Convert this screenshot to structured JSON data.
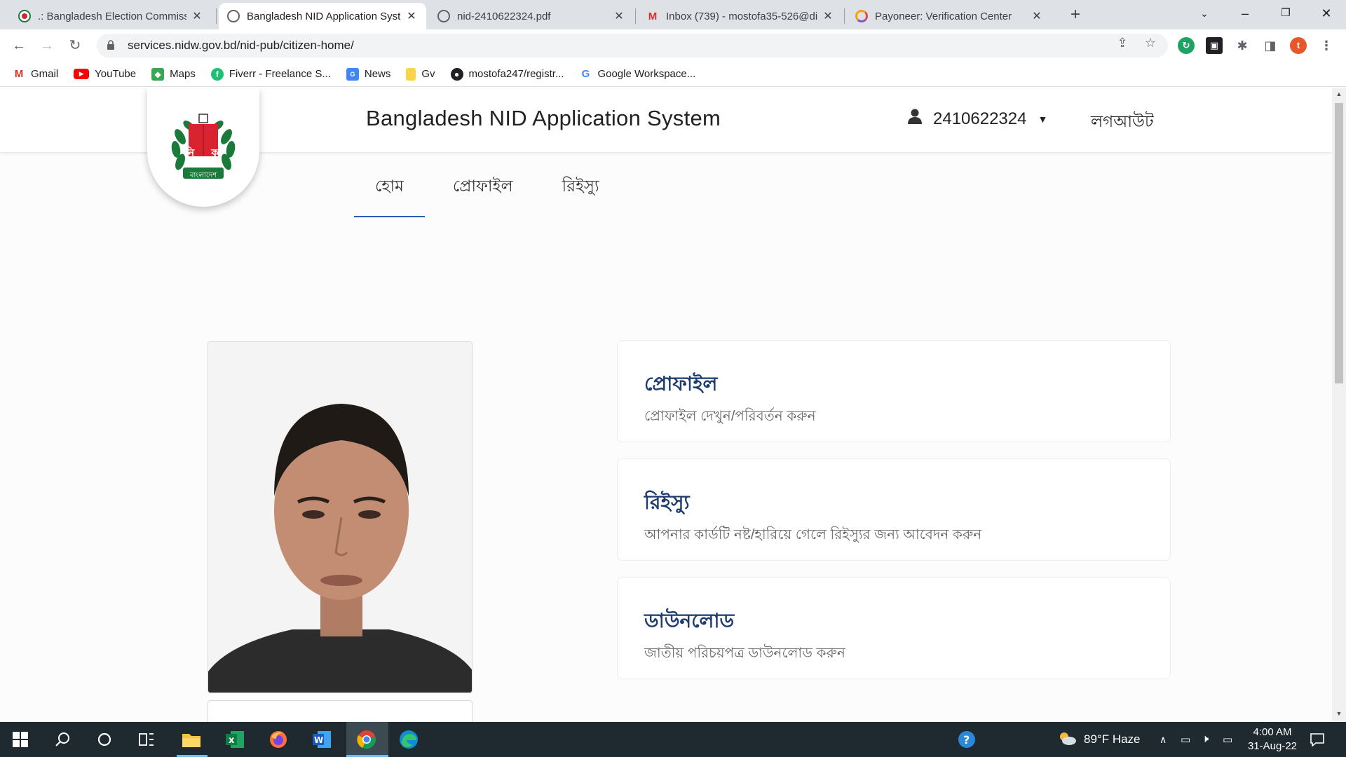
{
  "browser": {
    "tabs": [
      {
        "title": ".: Bangladesh Election Commissio",
        "favicon": "ec-logo-icon"
      },
      {
        "title": "Bangladesh NID Application Syst",
        "favicon": "globe-icon",
        "active": true
      },
      {
        "title": "nid-2410622324.pdf",
        "favicon": "globe-icon"
      },
      {
        "title": "Inbox (739) - mostofa35-526@di",
        "favicon": "gmail-icon"
      },
      {
        "title": "Payoneer: Verification Center",
        "favicon": "payoneer-icon"
      }
    ],
    "url": "services.nidw.gov.bd/nid-pub/citizen-home/",
    "profile_initial": "t",
    "bookmarks": [
      {
        "label": "Gmail",
        "icon": "gmail-icon"
      },
      {
        "label": "YouTube",
        "icon": "youtube-icon"
      },
      {
        "label": "Maps",
        "icon": "maps-icon"
      },
      {
        "label": "Fiverr - Freelance S...",
        "icon": "fiverr-icon"
      },
      {
        "label": "News",
        "icon": "news-icon"
      },
      {
        "label": "Gv",
        "icon": "folder-icon"
      },
      {
        "label": "mostofa247/registr...",
        "icon": "github-icon"
      },
      {
        "label": "Google Workspace...",
        "icon": "google-icon"
      }
    ]
  },
  "site": {
    "title": "Bangladesh NID Application System",
    "user_id": "2410622324",
    "logout": "লগআউট",
    "logo_text": "বাংলাদেশ",
    "logo_letters": "নি ক",
    "nav": [
      {
        "label": "হোম",
        "active": true
      },
      {
        "label": "প্রোফাইল"
      },
      {
        "label": "রিইস্যু"
      }
    ],
    "cards": [
      {
        "title": "প্রোফাইল",
        "subtitle": "প্রোফাইল দেখুন/পরিবর্তন করুন"
      },
      {
        "title": "রিইস্যু",
        "subtitle": "আপনার কার্ডটি নষ্ট/হারিয়ে গেলে রিইস্যুর জন্য আবেদন করুন"
      },
      {
        "title": "ডাউনলোড",
        "subtitle": "জাতীয় পরিচয়পত্র ডাউনলোড করুন"
      }
    ]
  },
  "taskbar": {
    "weather": "89°F  Haze",
    "time": "4:00 AM",
    "date": "31-Aug-22"
  },
  "colors": {
    "accent": "#2a5fb0",
    "card_title": "#1d3b6e",
    "taskbar": "#1f2a30",
    "logo_green": "#1a7a3a",
    "logo_red": "#d9232e"
  }
}
